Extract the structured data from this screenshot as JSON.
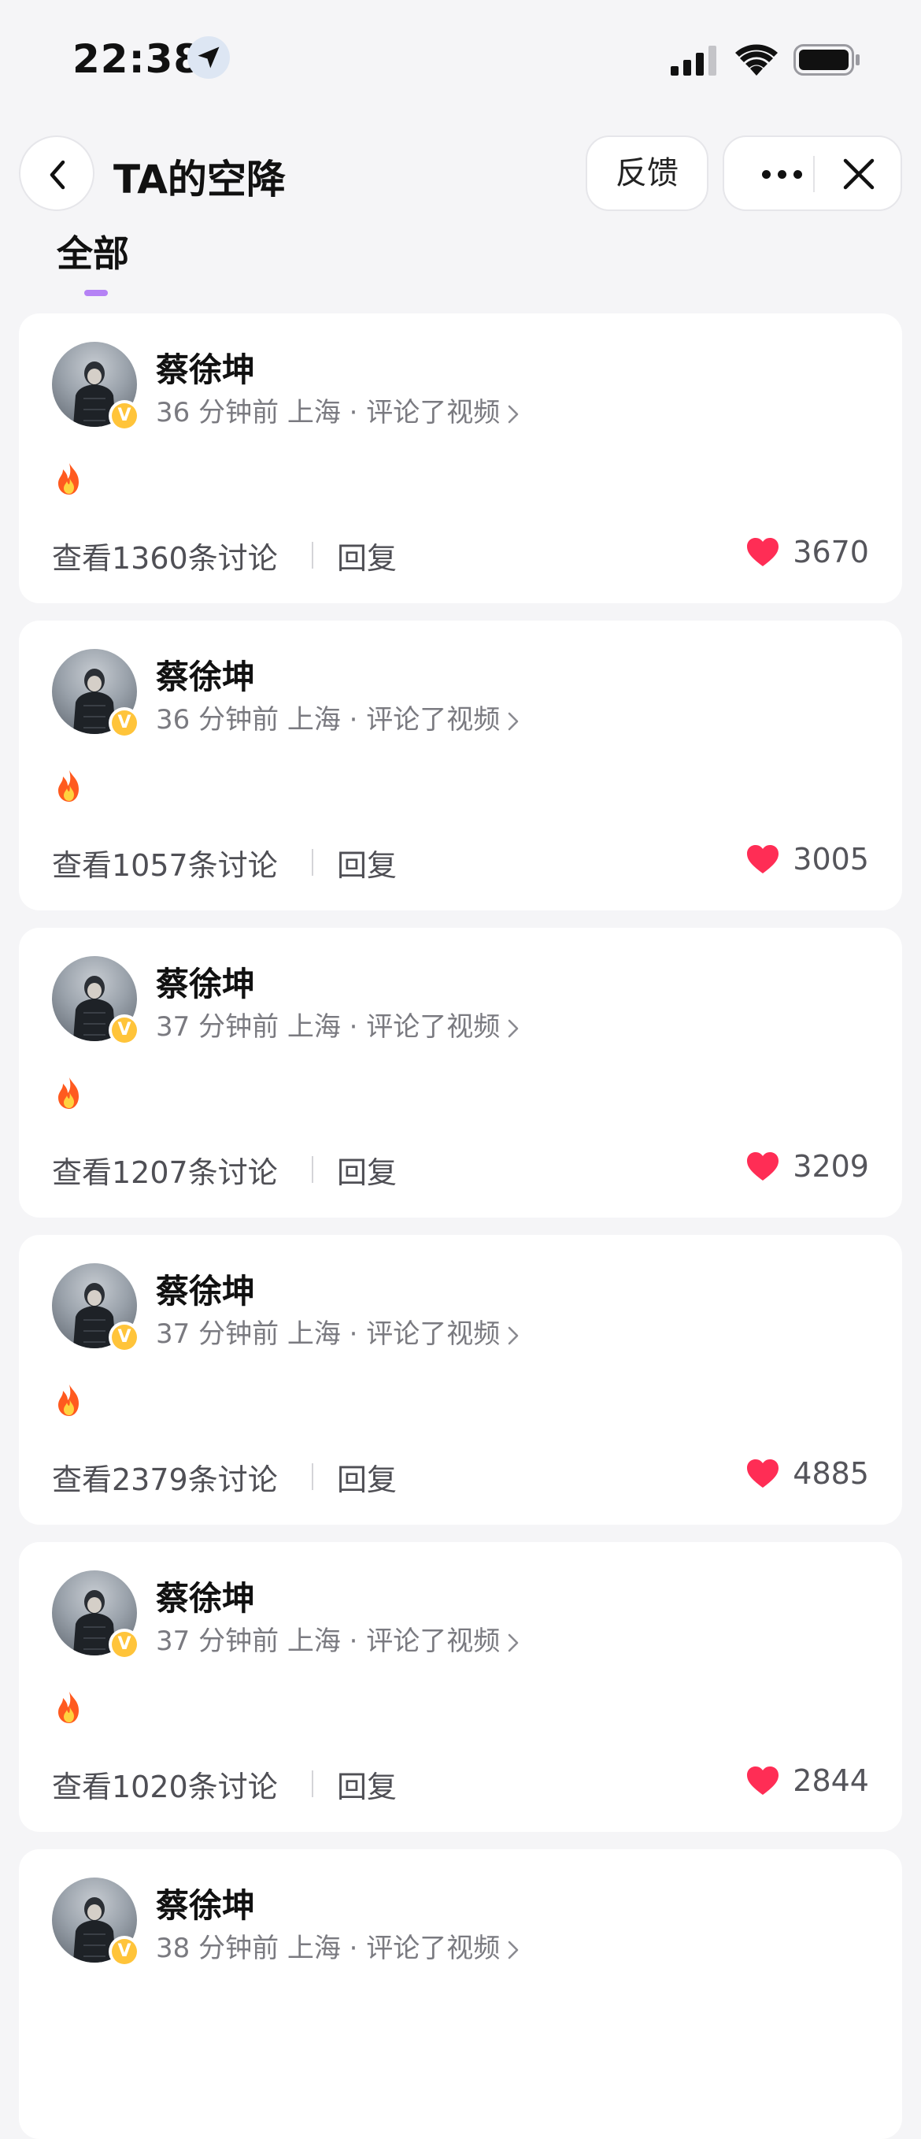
{
  "status_bar": {
    "time": "22:38"
  },
  "nav": {
    "title": "TA的空降",
    "feedback_label": "反馈"
  },
  "tabs": [
    {
      "label": "全部",
      "active": true
    }
  ],
  "accent": {
    "tab_indicator": "#b582f5",
    "heart": "#ff2d55",
    "verified": "#ffc43a"
  },
  "icons": [
    "location-arrow-icon",
    "signal-icon",
    "wifi-icon",
    "battery-icon",
    "back-chevron-icon",
    "more-icon",
    "close-icon",
    "fire-icon",
    "heart-icon",
    "verified-badge-icon"
  ],
  "cards": [
    {
      "name": "蔡徐坤",
      "meta": "36 分钟前 上海 · 评论了视频",
      "content": "🔥",
      "discussions": "查看1360条讨论",
      "reply": "回复",
      "likes": "3670"
    },
    {
      "name": "蔡徐坤",
      "meta": "36 分钟前 上海 · 评论了视频",
      "content": "🔥",
      "discussions": "查看1057条讨论",
      "reply": "回复",
      "likes": "3005"
    },
    {
      "name": "蔡徐坤",
      "meta": "37 分钟前 上海 · 评论了视频",
      "content": "🔥",
      "discussions": "查看1207条讨论",
      "reply": "回复",
      "likes": "3209"
    },
    {
      "name": "蔡徐坤",
      "meta": "37 分钟前 上海 · 评论了视频",
      "content": "🔥",
      "discussions": "查看2379条讨论",
      "reply": "回复",
      "likes": "4885"
    },
    {
      "name": "蔡徐坤",
      "meta": "37 分钟前 上海 · 评论了视频",
      "content": "🔥",
      "discussions": "查看1020条讨论",
      "reply": "回复",
      "likes": "2844"
    },
    {
      "name": "蔡徐坤",
      "meta": "38 分钟前 上海 · 评论了视频"
    }
  ]
}
